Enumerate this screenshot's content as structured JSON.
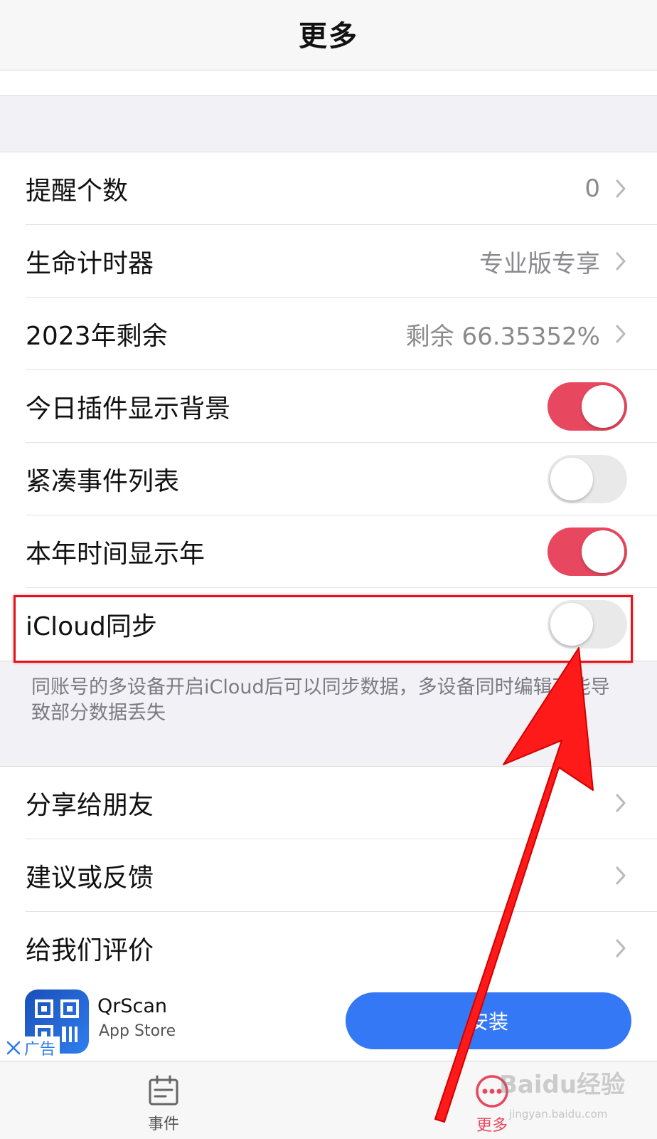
{
  "navbar": {
    "title": "更多"
  },
  "settings": {
    "reminder_count": {
      "label": "提醒个数",
      "value": "0"
    },
    "life_timer": {
      "label": "生命计时器",
      "value": "专业版专享"
    },
    "year_remaining": {
      "label": "2023年剩余",
      "value": "剩余 66.35352%"
    },
    "widget_background": {
      "label": "今日插件显示背景",
      "on": true
    },
    "compact_list": {
      "label": "紧凑事件列表",
      "on": false
    },
    "show_year": {
      "label": "本年时间显示年",
      "on": true
    },
    "icloud_sync": {
      "label": "iCloud同步",
      "on": false
    },
    "icloud_note": "同账号的多设备开启iCloud后可以同步数据，多设备同时编辑可能导致部分数据丢失",
    "share": {
      "label": "分享给朋友"
    },
    "feedback": {
      "label": "建议或反馈"
    },
    "rate": {
      "label": "给我们评价"
    }
  },
  "ad": {
    "app_name": "QrScan",
    "store": "App Store",
    "tag": "广告",
    "install_label": "安装"
  },
  "tabbar": {
    "events": "事件",
    "more": "更多"
  },
  "watermark": {
    "brand": "Baidu经验",
    "url": "jingyan.baidu.com"
  },
  "colors": {
    "accent": "#e8485f",
    "install_blue": "#3478f6",
    "highlight_red": "#e2141d"
  }
}
